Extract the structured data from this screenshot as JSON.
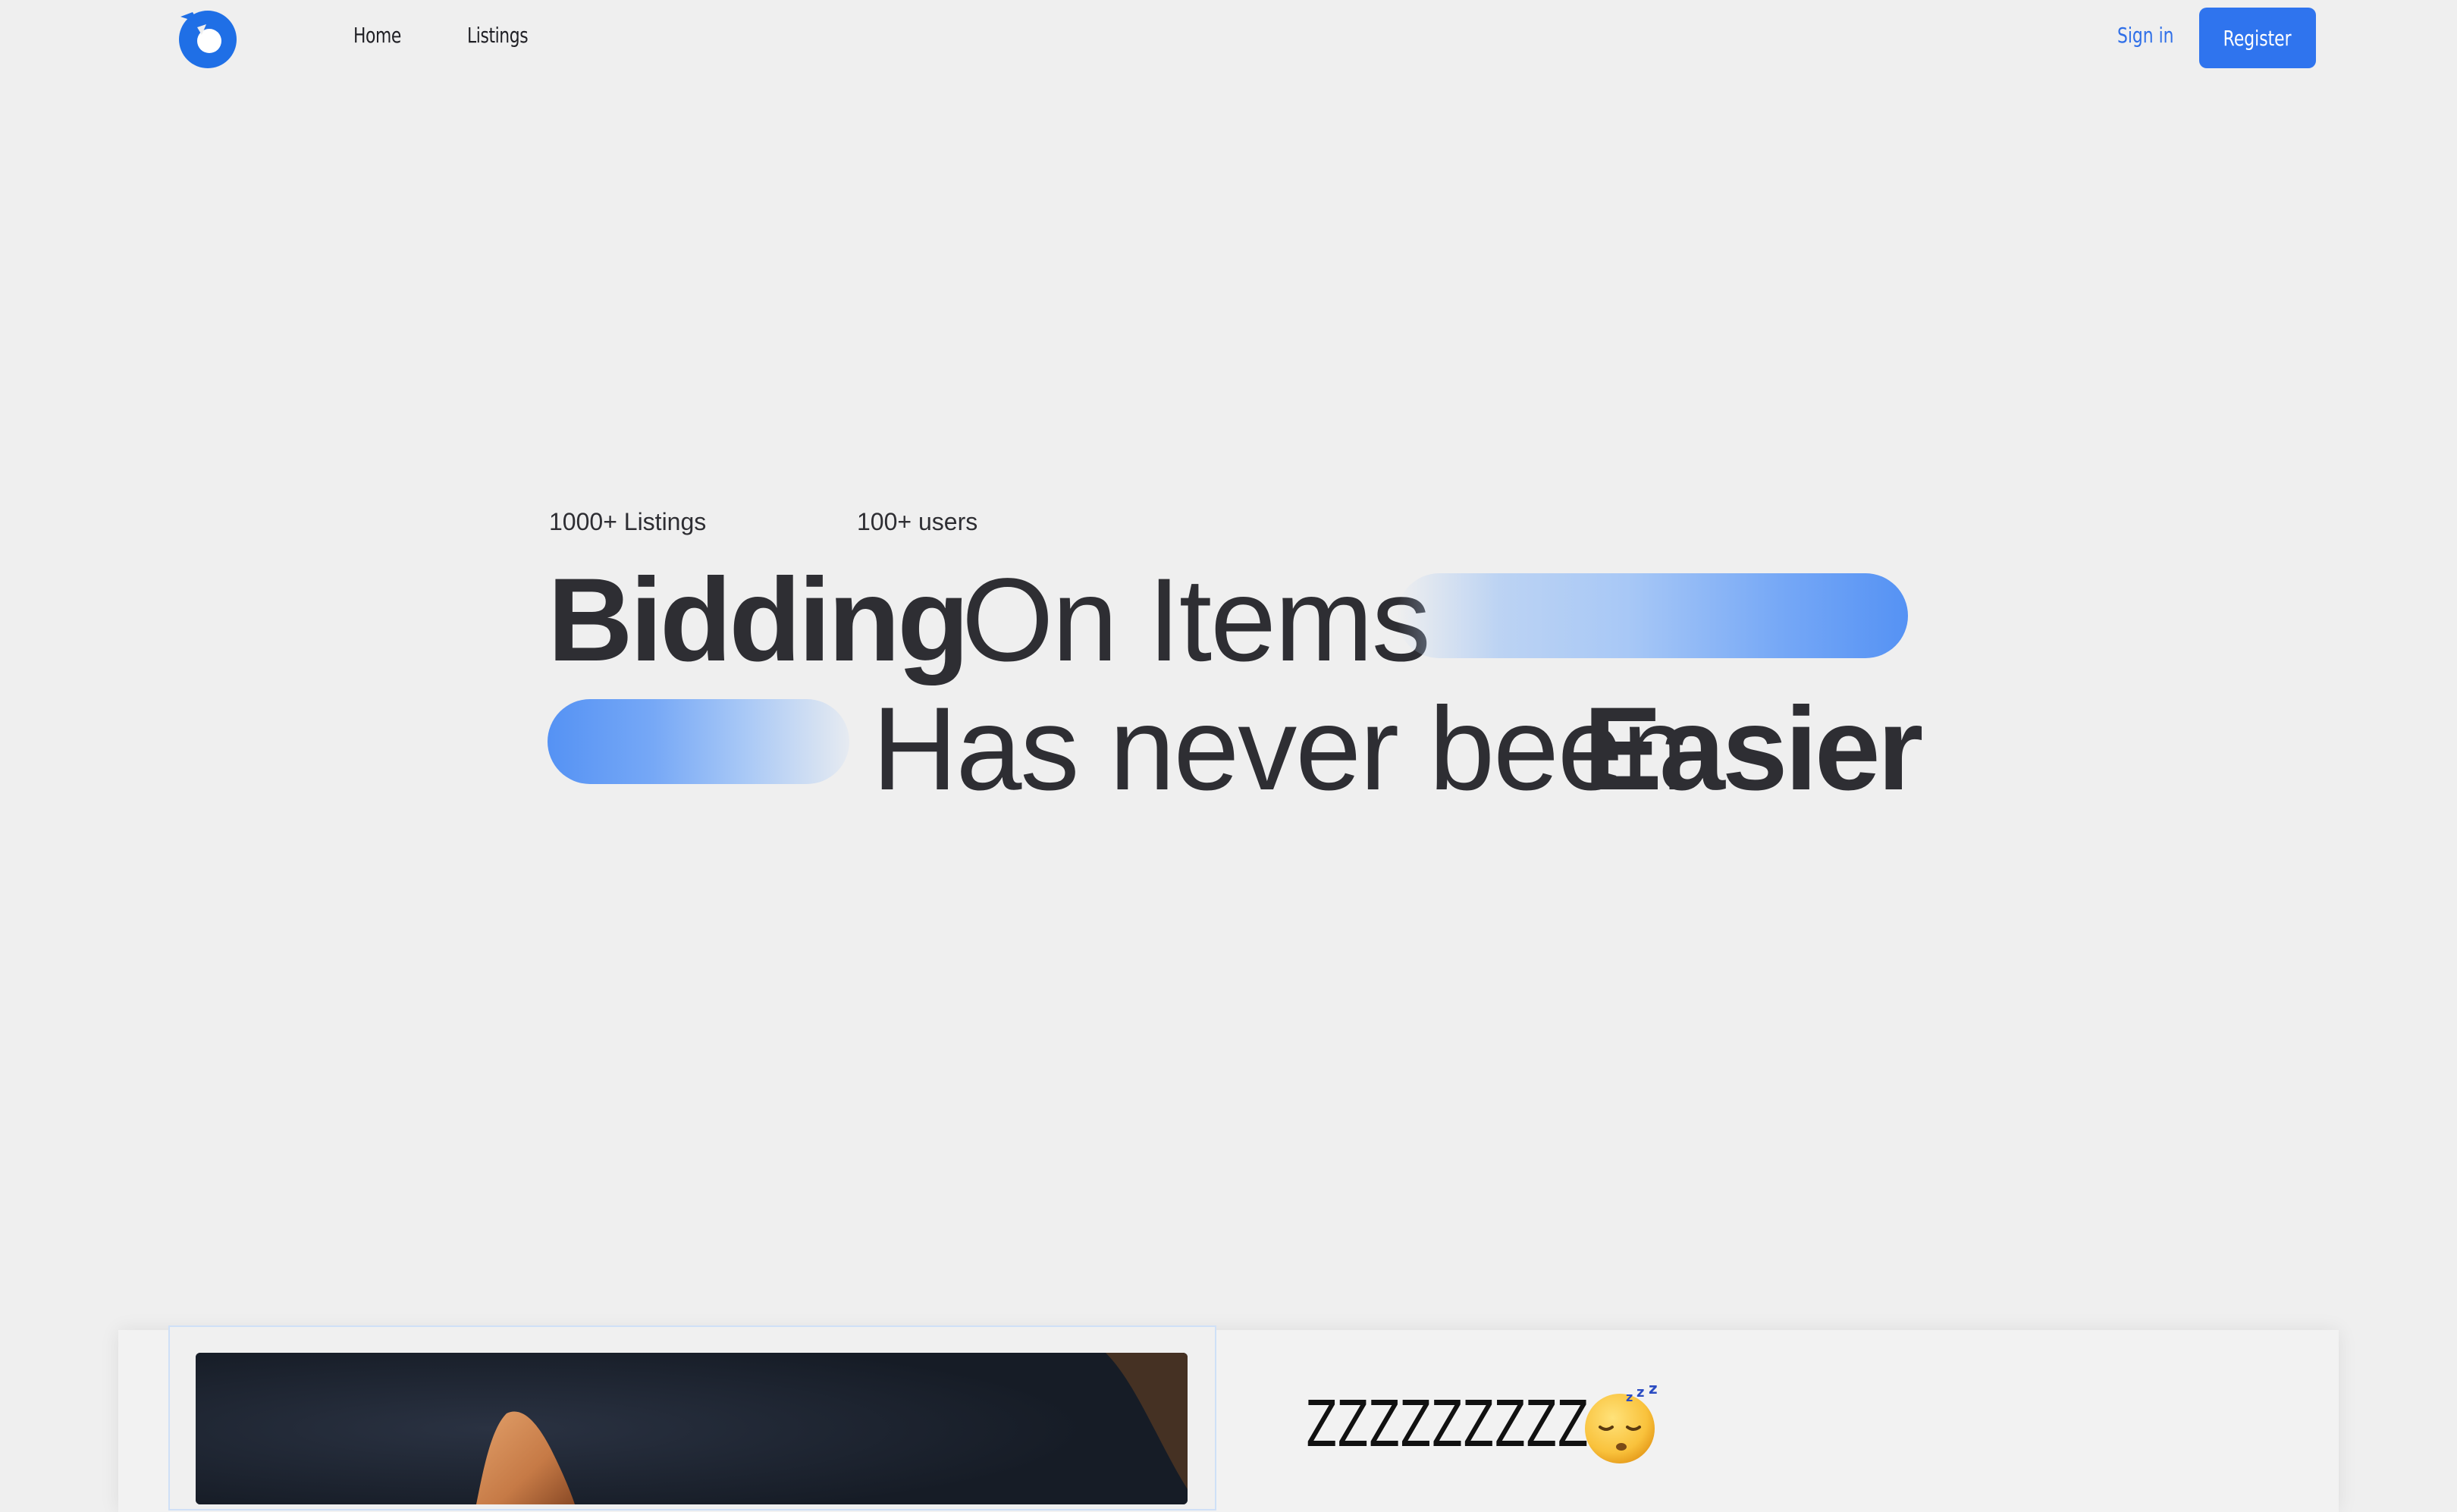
{
  "navbar": {
    "logo_icon": "logo-icon",
    "links": [
      {
        "label": "Home"
      },
      {
        "label": "Listings"
      }
    ],
    "signin_label": "Sign in",
    "register_label": "Register"
  },
  "hero": {
    "stats": [
      {
        "label": "1000+ Listings"
      },
      {
        "label": "100+ users"
      }
    ],
    "line1": {
      "bold": "Bidding",
      "light": "On Items"
    },
    "line2": {
      "light": "Has never been",
      "bold": "Easier"
    }
  },
  "featured": {
    "title": "ZZZZZZZZZ",
    "emoji_icon": "sleeping-face-icon"
  },
  "colors": {
    "accent": "#2f74ee",
    "link": "#2f6fe8",
    "text": "#2e2e33",
    "background": "#efefef"
  }
}
